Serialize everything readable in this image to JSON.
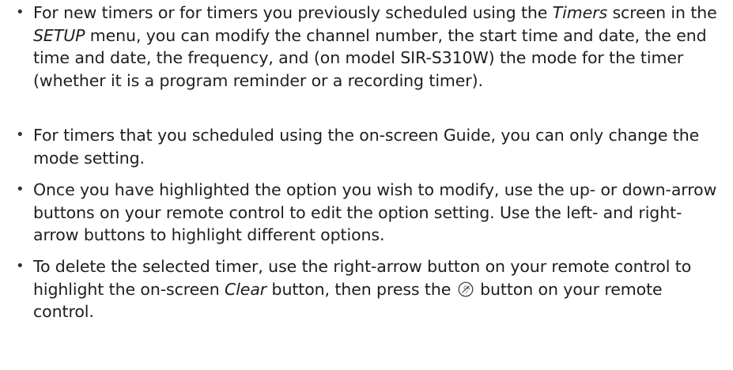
{
  "bullets": [
    {
      "symbol": "•",
      "t1": "For new timers or for timers you previously scheduled using the ",
      "i1": "Timers",
      "t2": " screen in the ",
      "i2": "SETUP",
      "t3": " menu, you can modify the channel number, the start time and date, the end time and date, the frequency, and (on model SIR-S310W) the mode for the timer (whether it is a program reminder or a recording timer)."
    },
    {
      "symbol": "•",
      "t1": "For timers that you scheduled using the on-screen Guide, you can only change the mode setting."
    },
    {
      "symbol": "•",
      "t1": "Once you have highlighted the option you wish to modify, use the up- or down-arrow buttons on your remote control to edit the option setting. Use the left- and right-arrow buttons to highlight different options."
    },
    {
      "symbol": "•",
      "t1": "To delete the selected timer, use the right-arrow button on your remote control to highlight the on-screen ",
      "i1": "Clear",
      "t2": " button, then press the ",
      "icon": "ok-button-icon",
      "t3": " button on your remote control."
    }
  ]
}
